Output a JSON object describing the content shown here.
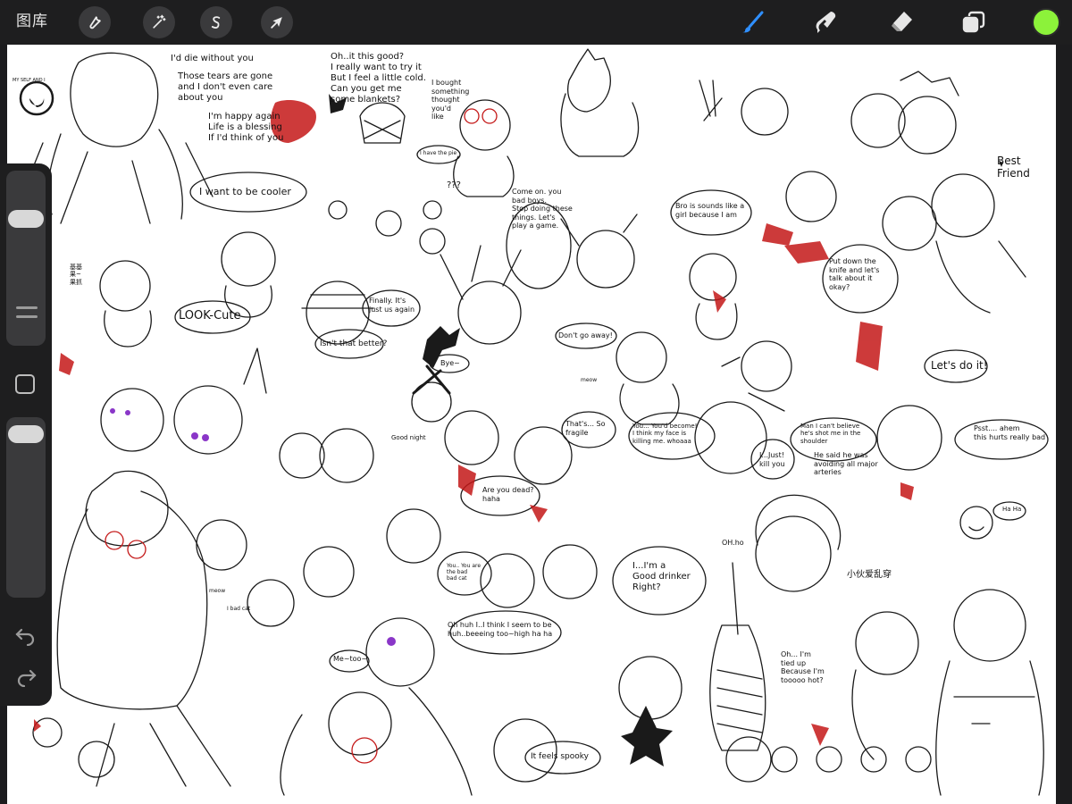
{
  "app": {
    "gallery_label": "图库",
    "accent_color": "#2f8fff",
    "current_color": "#8cf23a"
  },
  "toolbar": {
    "left_tools": [
      {
        "name": "adjustments",
        "icon": "wrench-icon"
      },
      {
        "name": "adjustments-magic",
        "icon": "magic-wand-icon"
      },
      {
        "name": "selection",
        "icon": "selection-s-icon"
      },
      {
        "name": "transform",
        "icon": "arrow-cursor-icon"
      }
    ],
    "right_tools": [
      {
        "name": "brush",
        "icon": "brush-icon",
        "active": true
      },
      {
        "name": "smudge",
        "icon": "smudge-icon",
        "active": false
      },
      {
        "name": "eraser",
        "icon": "eraser-icon",
        "active": false
      },
      {
        "name": "layers",
        "icon": "layers-icon",
        "active": false
      }
    ]
  },
  "sidebar": {
    "brush_size": 0.75,
    "opacity": 0.95,
    "icons": [
      "modify-square-icon",
      "undo-icon",
      "redo-icon"
    ]
  },
  "canvas_text": {
    "t1": "I'd die without you",
    "t2": "Those tears are gone\nand I don't even care\nabout you",
    "t3": "I'm happy again\nLife is a blessing\nIf I'd think of you",
    "t4": "Oh..it this good?\nI really want to try it\nBut I feel a little cold.\nCan you get me\nsome blankets?",
    "t5": "I bought\nsomething\nthought\nyou'd\nlike",
    "t6": "I have the pie",
    "t7": "I want to be cooler",
    "t8": "???",
    "t9": "Come on. you\nbad boys.\nStop doing these\nthings. Let's\nplay a game.",
    "t10": "Bro is sounds like a\ngirl because I am",
    "t11": "Best Friend",
    "t12": "Put down the\nknife and let's\ntalk about it\nokay?",
    "t13": "Let's do it!",
    "t14": "LOOK-Cute",
    "t15": "Finally. It's\njust us again",
    "t16": "Isn't that better?",
    "t17": "Bye~",
    "t18": "Don't go away!",
    "t19": "meow",
    "t20": "Good night",
    "t21": "That's... So\nfragile",
    "t22": "You... You'd become!\nI think my face is\nkilling me. whoaaa",
    "t23": "I...Just!\nkill you",
    "t24": "Man I can't believe\nhe's shot me in the\nshoulder",
    "t25": "He said he was\navoiding all major\narteries",
    "t26": "Psst.... ahem\nthis hurts really bad",
    "t27": "Are you dead?\nhaha",
    "t28": "Ha Ha",
    "t29": "OH.ho",
    "t30": "小伙爱乱穿",
    "t31": "I...I'm a\nGood drinker\nRight?",
    "t32": "You.. You are\nthe bad\nbad cat",
    "t33": "Oh huh I..I think I seem to be\nhuh..beeeing too~high ha ha",
    "t34": "meow",
    "t35": "I bad cat",
    "t36": "Me~too~",
    "t37": "Oh... I'm\ntied up\nBecause I'm\ntooooo hot?",
    "t38": "It feels spooky",
    "t39": "MY SELF AND I",
    "t40": "基基果~果抓"
  }
}
